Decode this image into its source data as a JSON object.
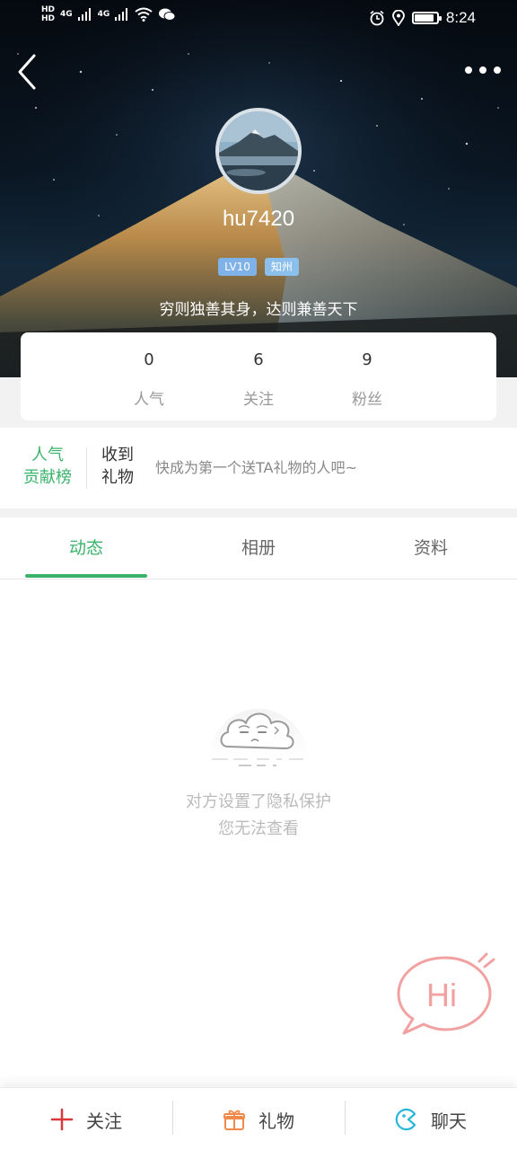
{
  "status_bar": {
    "time": "8:24",
    "network_1": "4G",
    "network_2": "4G",
    "hd_1": "HD",
    "hd_2": "HD",
    "battery_level": 0.8
  },
  "profile": {
    "username": "hu7420",
    "level_badge": "LV10",
    "city_badge": "知州",
    "signature": "穷则独善其身，达则兼善天下"
  },
  "stats": [
    {
      "value": "0",
      "label": "人气"
    },
    {
      "value": "6",
      "label": "关注"
    },
    {
      "value": "9",
      "label": "粉丝"
    }
  ],
  "gift_section": {
    "rank_line1": "人气",
    "rank_line2": "贡献榜",
    "received_line1": "收到",
    "received_line2": "礼物",
    "hint": "快成为第一个送TA礼物的人吧~"
  },
  "tabs": [
    {
      "label": "动态",
      "active": true
    },
    {
      "label": "相册",
      "active": false
    },
    {
      "label": "资料",
      "active": false
    }
  ],
  "empty_state": {
    "line1": "对方设置了隐私保护",
    "line2": "您无法查看"
  },
  "hi_button": {
    "label": "Hi"
  },
  "bottom_bar": {
    "follow_label": "关注",
    "gift_label": "礼物",
    "chat_label": "聊天"
  },
  "colors": {
    "accent": "#3ab36b",
    "follow_icon": "#d9383f",
    "gift_icon": "#f08a4b",
    "chat_icon": "#29b6d8",
    "hi_bubble": "#f2a1a1"
  }
}
